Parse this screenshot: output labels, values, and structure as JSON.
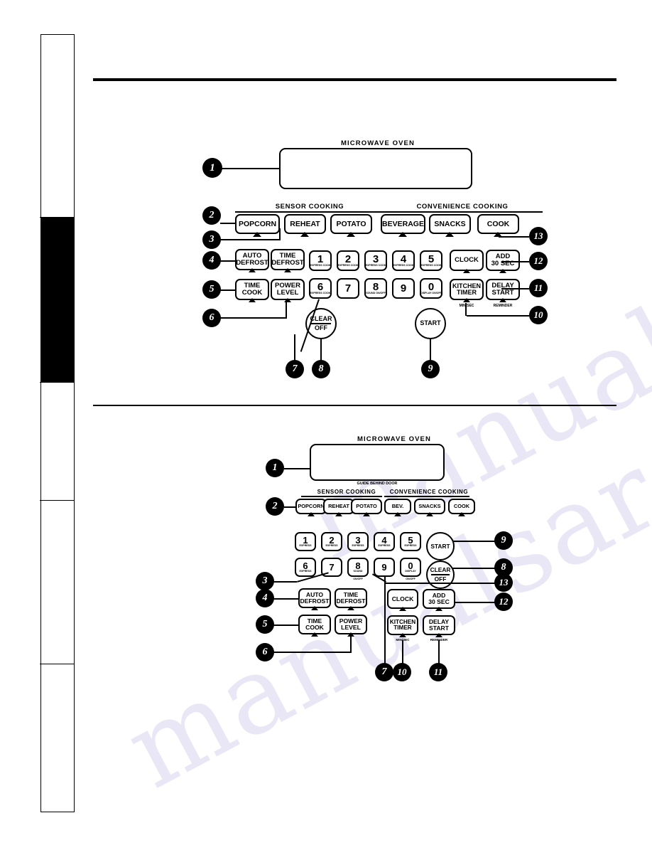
{
  "page": {
    "watermark_text_1": "manualsarchive",
    "watermark_text_2": "manualsarchive"
  },
  "panels": [
    {
      "id": "top",
      "oven_title": "MICROWAVE OVEN",
      "display_caption": "",
      "groups": [
        {
          "label": "SENSOR COOKING"
        },
        {
          "label": "CONVENIENCE COOKING"
        }
      ],
      "sensor_buttons": [
        {
          "label": "POPCORN"
        },
        {
          "label": "REHEAT"
        },
        {
          "label": "POTATO"
        }
      ],
      "convenience_buttons": [
        {
          "label": "BEVERAGE"
        },
        {
          "label": "SNACKS"
        },
        {
          "label": "COOK"
        }
      ],
      "function_buttons": [
        {
          "line1": "AUTO",
          "line2": "DEFROST"
        },
        {
          "line1": "TIME",
          "line2": "DEFROST"
        },
        {
          "line1": "TIME",
          "line2": "COOK"
        },
        {
          "line1": "POWER",
          "line2": "LEVEL"
        }
      ],
      "number_keys": [
        {
          "digit": "1",
          "sub": "EXPRESS COOK"
        },
        {
          "digit": "2",
          "sub": "EXPRESS COOK"
        },
        {
          "digit": "3",
          "sub": "EXPRESS COOK"
        },
        {
          "digit": "4",
          "sub": "EXPRESS COOK"
        },
        {
          "digit": "5",
          "sub": "EXPRESS COOK"
        },
        {
          "digit": "6",
          "sub": "EXPRESS COOK"
        },
        {
          "digit": "7",
          "sub": ""
        },
        {
          "digit": "8",
          "sub": "SOUND ON/OFF"
        },
        {
          "digit": "9",
          "sub": ""
        },
        {
          "digit": "0",
          "sub": "DISPLAY ON/OFF"
        }
      ],
      "right_buttons": [
        {
          "line1": "CLOCK",
          "line2": "",
          "under": ""
        },
        {
          "line1": "ADD",
          "line2": "30 SEC",
          "under": ""
        },
        {
          "line1": "KITCHEN",
          "line2": "TIMER",
          "under": "MIN/SEC"
        },
        {
          "line1": "DELAY",
          "line2": "START",
          "under": "REMINDER"
        }
      ],
      "clear_button": {
        "line1": "CLEAR",
        "line2": "OFF"
      },
      "start_button": {
        "label": "START"
      },
      "callouts": [
        "1",
        "2",
        "3",
        "4",
        "5",
        "6",
        "7",
        "8",
        "9",
        "10",
        "11",
        "12",
        "13"
      ]
    },
    {
      "id": "bottom",
      "oven_title": "MICROWAVE OVEN",
      "display_caption": "GUIDE BEHIND DOOR",
      "groups": [
        {
          "label": "SENSOR COOKING"
        },
        {
          "label": "CONVENIENCE COOKING"
        }
      ],
      "sensor_buttons": [
        {
          "label": "POPCORN"
        },
        {
          "label": "REHEAT"
        },
        {
          "label": "POTATO"
        }
      ],
      "convenience_buttons": [
        {
          "label": "BEV."
        },
        {
          "label": "SNACKS"
        },
        {
          "label": "COOK"
        }
      ],
      "function_buttons": [
        {
          "line1": "AUTO",
          "line2": "DEFROST"
        },
        {
          "line1": "TIME",
          "line2": "DEFROST"
        },
        {
          "line1": "TIME",
          "line2": "COOK"
        },
        {
          "line1": "POWER",
          "line2": "LEVEL"
        }
      ],
      "number_keys": [
        {
          "digit": "1",
          "sub": "EXPRESS",
          "sub2": ""
        },
        {
          "digit": "2",
          "sub": "EXPRESS",
          "sub2": ""
        },
        {
          "digit": "3",
          "sub": "EXPRESS",
          "sub2": ""
        },
        {
          "digit": "4",
          "sub": "EXPRESS",
          "sub2": ""
        },
        {
          "digit": "5",
          "sub": "EXPRESS",
          "sub2": ""
        },
        {
          "digit": "6",
          "sub": "EXPRESS",
          "sub2": ""
        },
        {
          "digit": "7",
          "sub": "",
          "sub2": ""
        },
        {
          "digit": "8",
          "sub": "SOUND",
          "sub2": "ON/OFF"
        },
        {
          "digit": "9",
          "sub": "",
          "sub2": ""
        },
        {
          "digit": "0",
          "sub": "DISPLAY",
          "sub2": "ON/OFF"
        }
      ],
      "right_buttons": [
        {
          "line1": "CLOCK",
          "line2": "",
          "under": ""
        },
        {
          "line1": "ADD",
          "line2": "30 SEC",
          "under": ""
        },
        {
          "line1": "KITCHEN",
          "line2": "TIMER",
          "under": "MIN/SEC"
        },
        {
          "line1": "DELAY",
          "line2": "START",
          "under": "REMINDER"
        }
      ],
      "clear_button": {
        "line1": "CLEAR",
        "line2": "OFF"
      },
      "start_button": {
        "label": "START"
      },
      "callouts": [
        "1",
        "2",
        "3",
        "4",
        "5",
        "6",
        "7",
        "8",
        "9",
        "10",
        "11",
        "12",
        "13"
      ]
    }
  ]
}
